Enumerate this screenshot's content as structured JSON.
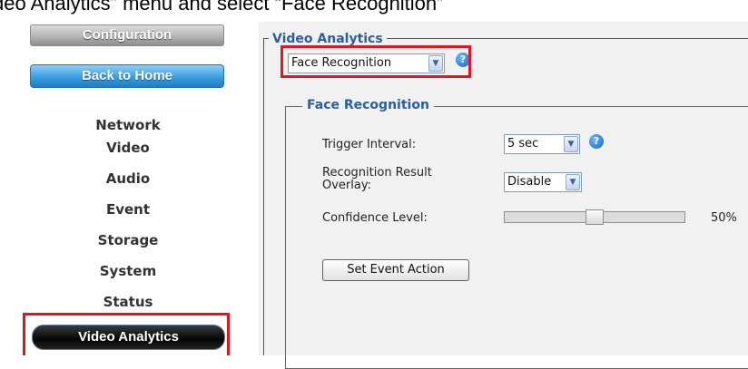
{
  "caption": "deo Analytics” menu and select “Face Recognition”",
  "sidebar": {
    "config_label": "Configuration",
    "home_label": "Back to Home",
    "items": [
      {
        "label": "Network"
      },
      {
        "label": "Video"
      },
      {
        "label": "Audio"
      },
      {
        "label": "Event"
      },
      {
        "label": "Storage"
      },
      {
        "label": "System"
      },
      {
        "label": "Status"
      },
      {
        "label": "Video Analytics"
      }
    ]
  },
  "video_analytics": {
    "legend": "Video Analytics",
    "selected": "Face Recognition",
    "help": "?"
  },
  "face_recognition": {
    "legend": "Face Recognition",
    "trigger_interval_label": "Trigger Interval:",
    "trigger_interval_value": "5 sec",
    "overlay_label_line1": "Recognition Result",
    "overlay_label_line2": "Overlay:",
    "overlay_value": "Disable",
    "confidence_label": "Confidence Level:",
    "confidence_value": 50,
    "confidence_text": "50%",
    "set_event_action_label": "Set Event Action"
  },
  "colors": {
    "highlight": "#e8141c",
    "legend_text": "#2a5ea8",
    "home_button": "#3a9ee0"
  },
  "icons": {
    "dropdown": "chevron-down-icon",
    "help": "help-icon"
  }
}
